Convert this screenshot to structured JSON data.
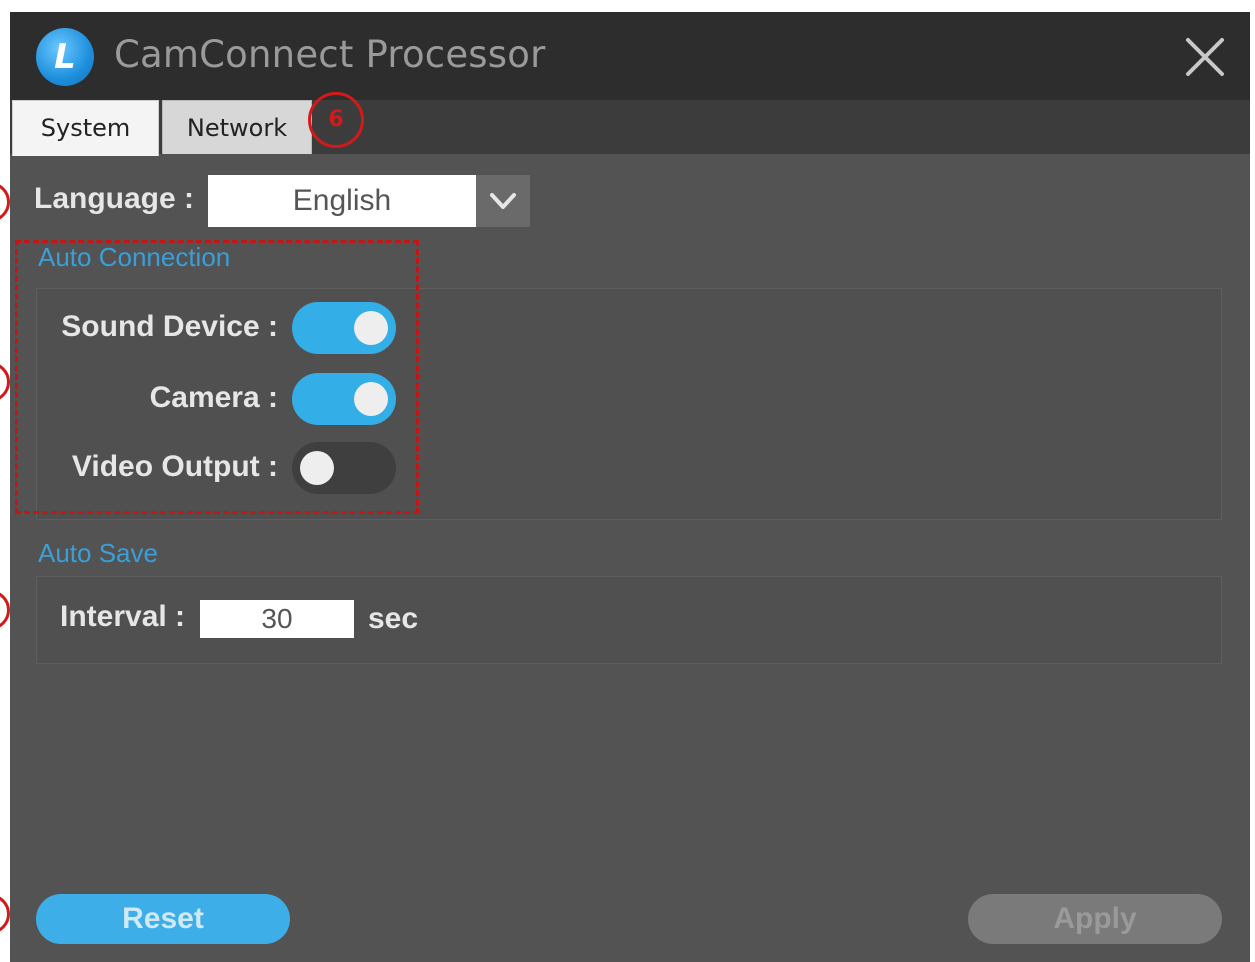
{
  "window": {
    "title": "CamConnect Processor",
    "logo_letter": "L"
  },
  "tabs": [
    {
      "label": "System",
      "active": true
    },
    {
      "label": "Network",
      "active": false
    }
  ],
  "annotation_marker": "6",
  "language": {
    "label": "Language :",
    "value": "English"
  },
  "auto_connection": {
    "title": "Auto Connection",
    "items": [
      {
        "label": "Sound Device :",
        "on": true
      },
      {
        "label": "Camera :",
        "on": true
      },
      {
        "label": "Video Output :",
        "on": false
      }
    ]
  },
  "auto_save": {
    "title": "Auto Save",
    "interval_label": "Interval :",
    "interval_value": "30",
    "unit": "sec"
  },
  "buttons": {
    "reset": "Reset",
    "apply": "Apply"
  },
  "colors": {
    "accent": "#34aee6",
    "section_title": "#3a9fd8",
    "annotation_red": "#d21a1a",
    "window_bg": "#535353",
    "titlebar_bg": "#2d2d2d"
  }
}
